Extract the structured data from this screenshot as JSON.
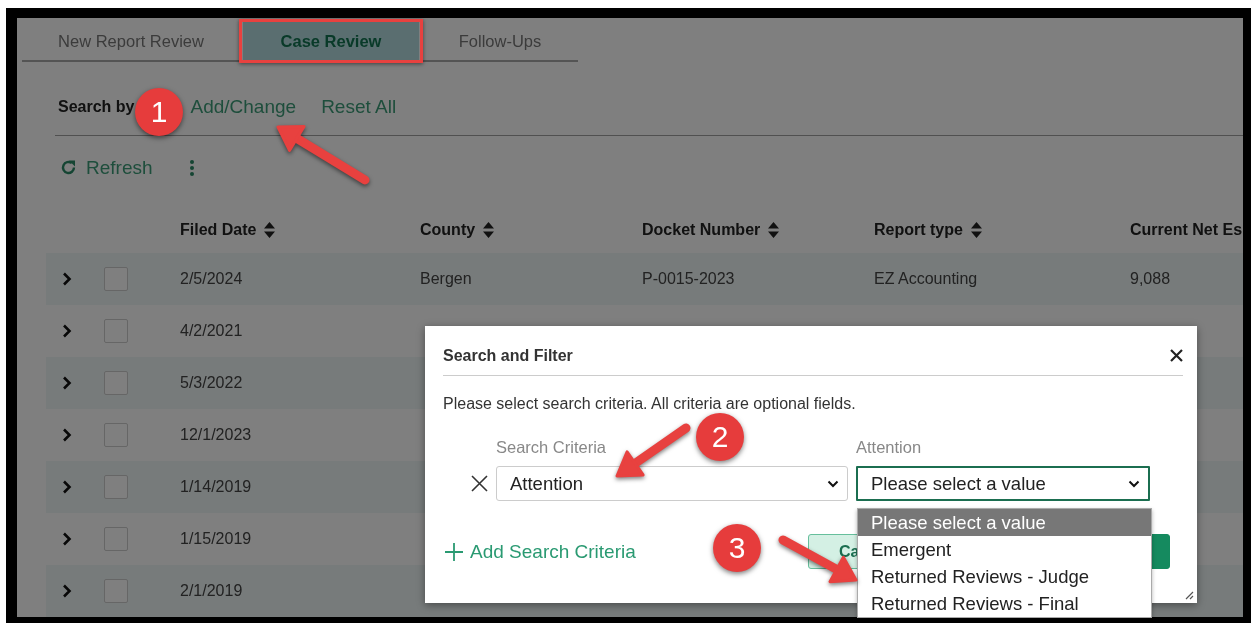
{
  "tabs": [
    {
      "label": "New Report Review",
      "selected": false
    },
    {
      "label": "Case Review",
      "selected": true
    },
    {
      "label": "Follow-Ups",
      "selected": false
    }
  ],
  "search_bar": {
    "label": "Search by",
    "links": [
      "Add/Change",
      "Reset All"
    ]
  },
  "toolbar": {
    "refresh": "Refresh"
  },
  "table": {
    "columns": [
      "Filed Date",
      "County",
      "Docket Number",
      "Report type",
      "Current Net Es"
    ],
    "rows": [
      {
        "expanded": false,
        "checked": false,
        "cells": [
          "2/5/2024",
          "Bergen",
          "P-0015-2023",
          "EZ Accounting",
          "9,088"
        ]
      },
      {
        "expanded": false,
        "checked": false,
        "cells": [
          "4/2/2021"
        ]
      },
      {
        "expanded": false,
        "checked": false,
        "cells": [
          "5/3/2022"
        ]
      },
      {
        "expanded": false,
        "checked": false,
        "cells": [
          "12/1/2023"
        ]
      },
      {
        "expanded": false,
        "checked": false,
        "cells": [
          "1/14/2019"
        ]
      },
      {
        "expanded": false,
        "checked": false,
        "cells": [
          "1/15/2019"
        ]
      },
      {
        "expanded": false,
        "checked": false,
        "cells": [
          "2/1/2019"
        ]
      }
    ]
  },
  "dialog": {
    "title": "Search and Filter",
    "instructions": "Please select search criteria. All criteria are optional fields.",
    "criteria": [
      {
        "label": "Search Criteria",
        "value": "Attention",
        "open": false
      },
      {
        "label": "Attention",
        "value": "Please select a value",
        "open": true
      }
    ],
    "options": [
      {
        "label": "Please select a value",
        "selected": true
      },
      {
        "label": "Emergent",
        "selected": false
      },
      {
        "label": "Returned Reviews - Judge",
        "selected": false
      },
      {
        "label": "Returned Reviews - Final",
        "selected": false
      }
    ],
    "add_link": "Add Search Criteria",
    "buttons": [
      {
        "kind": "secondary",
        "label": "Ca"
      },
      {
        "kind": "primary"
      }
    ]
  },
  "annotations": [
    {
      "number": "1"
    },
    {
      "number": "2"
    },
    {
      "number": "3"
    }
  ]
}
